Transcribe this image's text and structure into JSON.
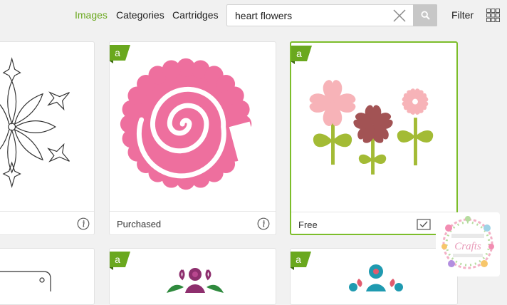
{
  "nav": {
    "images": "Images",
    "categories": "Categories",
    "cartridges": "Cartridges",
    "filter": "Filter"
  },
  "search": {
    "value": "heart flowers"
  },
  "cards": [
    {
      "status": ""
    },
    {
      "status": "Purchased"
    },
    {
      "status": "Free"
    }
  ],
  "badge": {
    "glyph": "a"
  },
  "logo": {
    "brand": "Crafts"
  },
  "colors": {
    "accent_green": "#6aa81e",
    "selected_border": "#7cbd2a",
    "rose_pink": "#ee6f9e",
    "light_pink": "#f7b3b8",
    "mauve": "#a25354",
    "leaf_green": "#a3bb35"
  },
  "icons": [
    "search-icon",
    "close-icon",
    "grid-view-icon",
    "info-icon",
    "checkbox-icon",
    "access-badge-icon"
  ]
}
